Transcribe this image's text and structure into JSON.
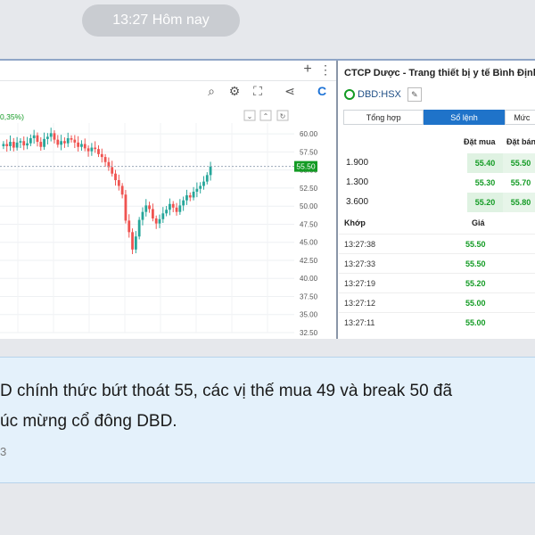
{
  "timestamp": "13:27 Hôm nay",
  "chart": {
    "pct_label": "0,35%)",
    "price_tag": "55.50",
    "chart_data": {
      "type": "candlestick",
      "ylim": [
        32.5,
        61.5
      ],
      "y_ticks": [
        "60.00",
        "57.50",
        "55.00",
        "52.50",
        "50.00",
        "47.50",
        "45.00",
        "42.50",
        "40.00",
        "37.50",
        "35.00",
        "32.50"
      ],
      "last_price": 55.5,
      "series": [
        {
          "values": [
            58.6,
            58.3,
            58.9,
            58.1,
            58.8,
            59.0,
            58.4,
            58.7,
            59.4,
            59.8,
            58.9,
            58.2,
            59.3,
            59.6,
            60.1,
            59.2,
            58.5,
            59.0,
            58.7,
            59.4,
            59.2,
            58.8,
            58.2,
            58.6,
            58.0,
            57.6,
            58.1,
            57.9,
            57.2,
            56.8,
            56.1,
            55.4,
            54.5,
            53.6,
            52.8,
            51.6,
            48.0,
            46.4,
            44.0,
            45.8,
            48.1,
            49.2,
            50.1,
            49.6,
            48.3,
            47.6,
            48.2,
            49.0,
            49.5,
            50.3,
            49.8,
            49.2,
            50.1,
            50.8,
            51.5,
            51.2,
            52.0,
            52.4,
            52.8,
            53.4,
            54.3,
            55.5
          ]
        }
      ]
    }
  },
  "panel": {
    "title": "CTCP Dược - Trang thiết bị y tế Bình Định",
    "ticker": "DBD:HSX",
    "tabs": [
      "Tổng hợp",
      "Sổ lệnh",
      "Mức"
    ],
    "bid_header": "Đặt mua",
    "ask_header": "Đặt bán",
    "book": [
      {
        "vol": "1.900",
        "bid": "55.40",
        "ask": "55.50"
      },
      {
        "vol": "1.300",
        "bid": "55.30",
        "ask": "55.70"
      },
      {
        "vol": "3.600",
        "bid": "55.20",
        "ask": "55.80"
      }
    ],
    "match_header": "Khớp",
    "price_header": "Giá",
    "trades": [
      {
        "time": "13:27:38",
        "price": "55.50"
      },
      {
        "time": "13:27:33",
        "price": "55.50"
      },
      {
        "time": "13:27:19",
        "price": "55.20"
      },
      {
        "time": "13:27:12",
        "price": "55.00"
      },
      {
        "time": "13:27:11",
        "price": "55.00"
      }
    ]
  },
  "message": {
    "line1": "D chính thức bứt thoát 55, các vị thế mua 49 và break 50 đã",
    "line2": "úc mừng cổ đông DBD.",
    "meta": "3"
  }
}
